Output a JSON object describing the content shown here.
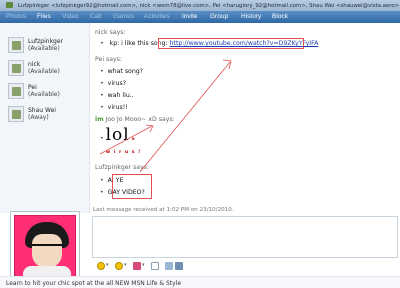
{
  "titlebar": {
    "text": "Lufzpinkger <lufzpinkger92@hotmail.com>, nick <wem78@live.com>, Pei <haruglory_92@hotmail.com>, Shau Wei <shauwei@vista.aero>"
  },
  "menu": [
    "Photos",
    "Files",
    "Video",
    "Call",
    "Games",
    "Activities",
    "Invite",
    "Group",
    "History",
    "Block"
  ],
  "contacts": [
    {
      "name": "Lufzpinkger",
      "status": "(Available)"
    },
    {
      "name": "nick",
      "status": "(Available)"
    },
    {
      "name": "Pei",
      "status": "(Available)"
    },
    {
      "name": "Shau Wei",
      "status": "(Away)"
    }
  ],
  "conversation": {
    "nick_says": "nick says:",
    "nick_msg_prefix": "kp: i like this song:",
    "nick_msg_link": "http://www.youtube.com/watch?v=D9ZKyYFyIFA",
    "pei_says": "Pei says:",
    "pei_msgs": [
      "what song?",
      "virus?",
      "wah liu..",
      "virus!!"
    ],
    "emote_prefix": "im",
    "emote_name": "Joo Jo Mooo~ xD says:",
    "lol_text": "lol",
    "lol_sub_x": "x",
    "lol_sub": "w i r u s !",
    "lufz_says": "Lufzpinkger says:",
    "lufz_msgs": [
      "AI YE",
      "GAY VIDEO?"
    ],
    "status": "Last message received at 1:02 PM on 23/10/2010."
  },
  "footer": {
    "text": "Learn to hit your chic spot at the all NEW MSN Life & Style"
  },
  "colors": {
    "menubar": "#2f68a6",
    "avatar_bg": "#ff2e77",
    "annotation": "#e05050"
  }
}
